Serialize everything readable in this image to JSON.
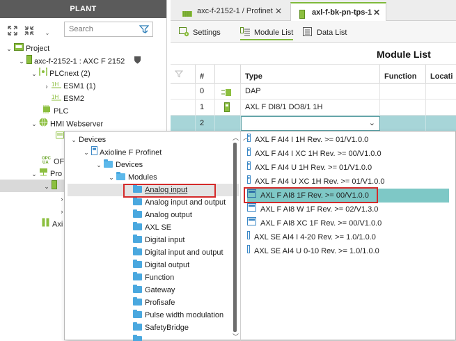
{
  "plant": {
    "header": "PLANT",
    "search_placeholder": "Search",
    "tree": [
      {
        "label": "Project"
      },
      {
        "label": "axc-f-2152-1 : AXC F 2152"
      },
      {
        "label": "PLCnext (2)"
      },
      {
        "label": "ESM1 (1)"
      },
      {
        "label": "ESM2"
      },
      {
        "label": "PLC"
      },
      {
        "label": "HMI Webserver"
      },
      {
        "label": "OF"
      },
      {
        "label": "Pro"
      },
      {
        "label": "Axi"
      }
    ]
  },
  "editor": {
    "tabs": [
      {
        "label": "axc-f-2152-1 / Profinet",
        "close": "✕"
      },
      {
        "label": "axl-f-bk-pn-tps-1",
        "close": "✕"
      }
    ],
    "subtabs": [
      {
        "label": "Settings"
      },
      {
        "label": "Module List"
      },
      {
        "label": "Data List"
      }
    ],
    "module_list_title": "Module List",
    "columns": [
      "#",
      "Type",
      "Function",
      "Locati"
    ],
    "rows": [
      {
        "num": "0",
        "type": "DAP"
      },
      {
        "num": "1",
        "type": "AXL F DI8/1 DO8/1 1H"
      },
      {
        "num": "2",
        "type": ""
      }
    ]
  },
  "popup": {
    "tree": [
      {
        "label": "Devices"
      },
      {
        "label": "Axioline F Profinet"
      },
      {
        "label": "Devices"
      },
      {
        "label": "Modules"
      },
      {
        "label": "Analog input"
      },
      {
        "label": "Analog input and output"
      },
      {
        "label": "Analog output"
      },
      {
        "label": "AXL SE"
      },
      {
        "label": "Digital input"
      },
      {
        "label": "Digital input and output"
      },
      {
        "label": "Digital output"
      },
      {
        "label": "Function"
      },
      {
        "label": "Gateway"
      },
      {
        "label": "Profisafe"
      },
      {
        "label": "Pulse width modulation"
      },
      {
        "label": "SafetyBridge"
      }
    ],
    "modules": [
      {
        "label": "AXL F AI4 I 1H Rev. >= 01/V1.0.0"
      },
      {
        "label": "AXL F AI4 I XC 1H Rev. >= 00/V1.0.0"
      },
      {
        "label": "AXL F AI4 U 1H Rev. >= 01/V1.0.0"
      },
      {
        "label": "AXL F AI4 U XC 1H Rev. >= 01/V1.0.0"
      },
      {
        "label": "AXL F AI8 1F Rev. >= 00/V1.0.0"
      },
      {
        "label": "AXL F AI8 W 1F Rev. >= 02/V1.3.0"
      },
      {
        "label": "AXL F AI8 XC 1F Rev. >= 00/V1.0.0"
      },
      {
        "label": "AXL SE AI4 I 4-20 Rev. >= 1.0/1.0.0"
      },
      {
        "label": "AXL SE AI4 U 0-10 Rev. >= 1.0/1.0.0"
      }
    ]
  },
  "colors": {
    "accent_green": "#7fb93b",
    "selection_teal": "#7ec8c6",
    "highlight_red": "#d42a2a",
    "folder_blue": "#4aa8df"
  }
}
